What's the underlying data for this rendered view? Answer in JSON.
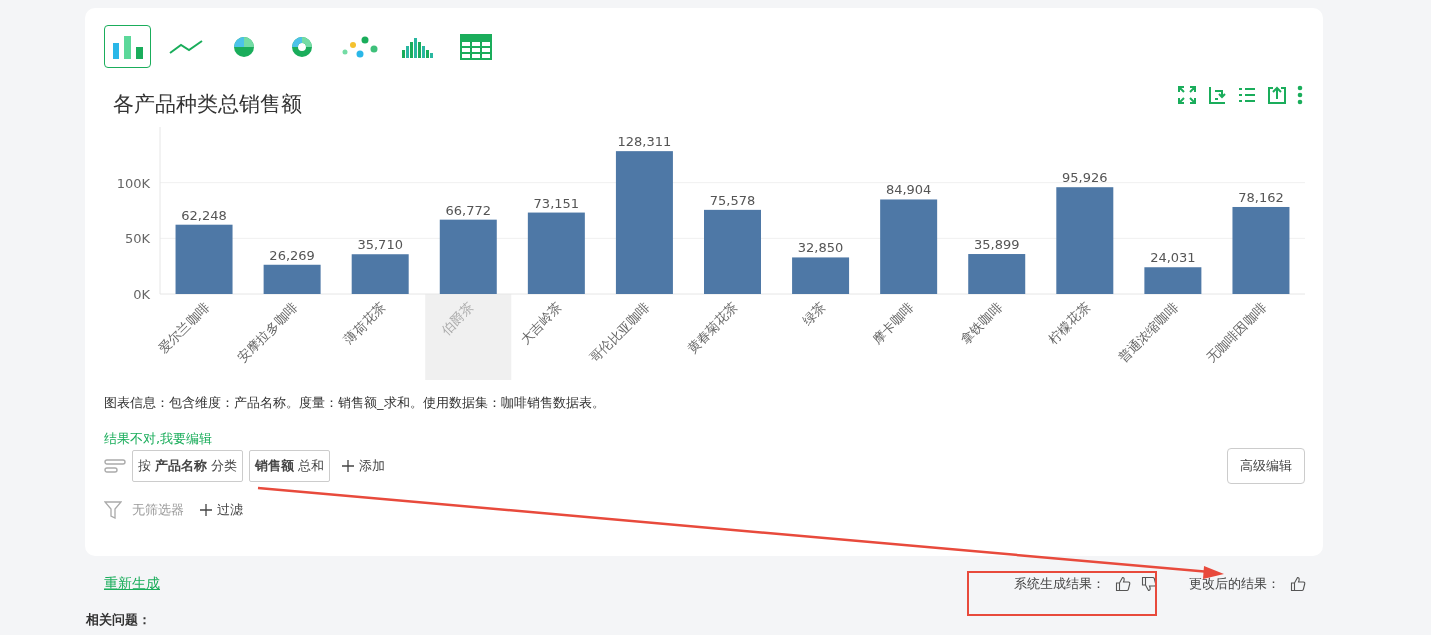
{
  "chart_types": [
    {
      "kind": "bar",
      "selected": true
    },
    {
      "kind": "line",
      "selected": false
    },
    {
      "kind": "pie",
      "selected": false
    },
    {
      "kind": "donut",
      "selected": false
    },
    {
      "kind": "scatter",
      "selected": false
    },
    {
      "kind": "histogram",
      "selected": false
    },
    {
      "kind": "table",
      "selected": false
    }
  ],
  "chart": {
    "title": "各产品种类总销售额",
    "hovered": [
      false,
      false,
      false,
      true,
      false,
      false,
      false,
      false,
      false,
      false,
      false,
      false,
      false
    ],
    "chart_data": {
      "type": "bar",
      "categories": [
        "爱尔兰咖啡",
        "安摩拉多咖啡",
        "薄荷花茶",
        "伯爵茶",
        "大吉岭茶",
        "哥伦比亚咖啡",
        "黄春菊花茶",
        "绿茶",
        "摩卡咖啡",
        "拿铁咖啡",
        "柠檬花茶",
        "普通浓缩咖啡",
        "无咖啡因咖啡"
      ],
      "series": [
        {
          "color": "#4e78a6",
          "values": [
            62248,
            26269,
            35710,
            66772,
            73151,
            128311,
            75578,
            32850,
            84904,
            35899,
            95926,
            24031,
            78162
          ]
        }
      ],
      "value_labels": [
        "62,248",
        "26,269",
        "35,710",
        "66,772",
        "73,151",
        "128,311",
        "75,578",
        "32,850",
        "84,904",
        "35,899",
        "95,926",
        "24,031",
        "78,162"
      ],
      "ylim": [
        0,
        150000
      ],
      "yticks": [
        {
          "value": 0,
          "label": "0K"
        },
        {
          "value": 50000,
          "label": "50K"
        },
        {
          "value": 100000,
          "label": "100K"
        }
      ]
    }
  },
  "info": "图表信息：包含维度：产品名称。度量：销售额_求和。使用数据集：咖啡销售数据表。",
  "edit_link": "结果不对,我要编辑",
  "dimension_pills": [
    "按 **产品名称** 分类",
    "**销售额** 总和"
  ],
  "add_button": "添加",
  "advanced_button": "高级编辑",
  "filter": {
    "empty": "无筛选器",
    "add": "过滤"
  },
  "regenerate_link": "重新生成",
  "feedback": {
    "system_label": "系统生成结果：",
    "changed_label": "更改后的结果："
  },
  "related_heading": "相关问题："
}
